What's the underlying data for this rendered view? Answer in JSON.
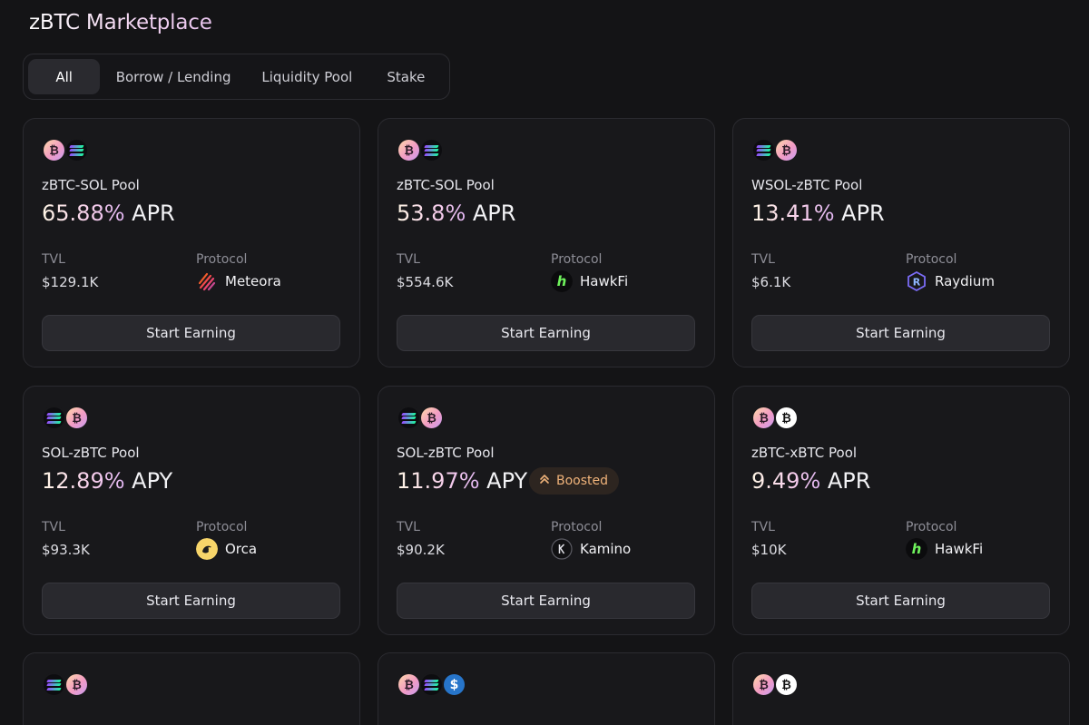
{
  "page_title": "zBTC Marketplace",
  "tabs": [
    {
      "label": "All",
      "active": true
    },
    {
      "label": "Borrow / Lending"
    },
    {
      "label": "Liquidity Pool"
    },
    {
      "label": "Stake"
    }
  ],
  "cards": [
    {
      "pool": "zBTC-SOL Pool",
      "rate": "65.88%",
      "rate_unit": "APR",
      "tvl_label": "TVL",
      "tvl": "$129.1K",
      "protocol_label": "Protocol",
      "protocol": "Meteora",
      "cta": "Start Earning",
      "icons": [
        "btc",
        "sol"
      ]
    },
    {
      "pool": "zBTC-SOL Pool",
      "rate": "53.8%",
      "rate_unit": "APR",
      "tvl_label": "TVL",
      "tvl": "$554.6K",
      "protocol_label": "Protocol",
      "protocol": "HawkFi",
      "cta": "Start Earning",
      "icons": [
        "btc",
        "sol"
      ]
    },
    {
      "pool": "WSOL-zBTC Pool",
      "rate": "13.41%",
      "rate_unit": "APR",
      "tvl_label": "TVL",
      "tvl": "$6.1K",
      "protocol_label": "Protocol",
      "protocol": "Raydium",
      "cta": "Start Earning",
      "icons": [
        "sol",
        "btc"
      ]
    },
    {
      "pool": "SOL-zBTC Pool",
      "rate": "12.89%",
      "rate_unit": "APY",
      "tvl_label": "TVL",
      "tvl": "$93.3K",
      "protocol_label": "Protocol",
      "protocol": "Orca",
      "cta": "Start Earning",
      "icons": [
        "sol",
        "btc"
      ]
    },
    {
      "pool": "SOL-zBTC Pool",
      "rate": "11.97%",
      "rate_unit": "APY",
      "badge": "Boosted",
      "tvl_label": "TVL",
      "tvl": "$90.2K",
      "protocol_label": "Protocol",
      "protocol": "Kamino",
      "cta": "Start Earning",
      "icons": [
        "sol",
        "btc"
      ]
    },
    {
      "pool": "zBTC-xBTC Pool",
      "rate": "9.49%",
      "rate_unit": "APR",
      "tvl_label": "TVL",
      "tvl": "$10K",
      "protocol_label": "Protocol",
      "protocol": "HawkFi",
      "cta": "Start Earning",
      "icons": [
        "btc",
        "xbtc"
      ]
    }
  ],
  "partial_cards": [
    {
      "icons": [
        "sol",
        "btc"
      ]
    },
    {
      "icons": [
        "btc",
        "sol",
        "usdc"
      ]
    },
    {
      "icons": [
        "btc",
        "xbtc"
      ]
    }
  ],
  "colors": {
    "background": "#141416",
    "card": "#18181b",
    "boost_text": "#f0b37a"
  }
}
